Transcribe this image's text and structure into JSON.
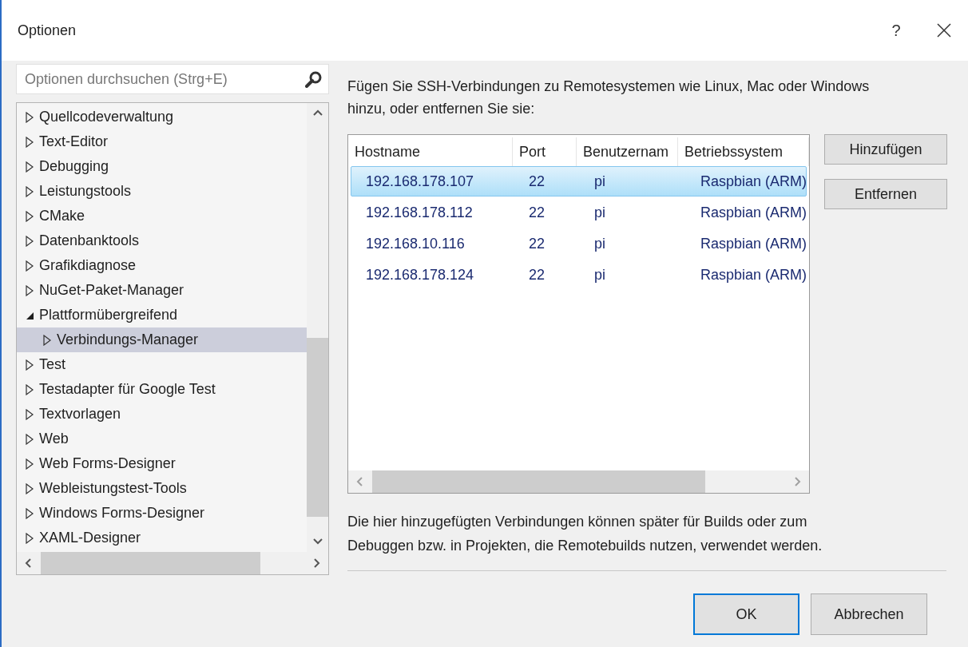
{
  "window": {
    "title": "Optionen",
    "help": "?"
  },
  "search": {
    "placeholder": "Optionen durchsuchen (Strg+E)"
  },
  "tree": [
    {
      "label": "Quellcodeverwaltung",
      "expanded": false,
      "selected": false
    },
    {
      "label": "Text-Editor",
      "expanded": false,
      "selected": false
    },
    {
      "label": "Debugging",
      "expanded": false,
      "selected": false
    },
    {
      "label": "Leistungstools",
      "expanded": false,
      "selected": false
    },
    {
      "label": "CMake",
      "expanded": false,
      "selected": false
    },
    {
      "label": "Datenbanktools",
      "expanded": false,
      "selected": false
    },
    {
      "label": "Grafikdiagnose",
      "expanded": false,
      "selected": false
    },
    {
      "label": "NuGet-Paket-Manager",
      "expanded": false,
      "selected": false
    },
    {
      "label": "Plattformübergreifend",
      "expanded": true,
      "selected": false,
      "children": [
        {
          "label": "Verbindungs-Manager",
          "expanded": false,
          "selected": true
        }
      ]
    },
    {
      "label": "Test",
      "expanded": false,
      "selected": false
    },
    {
      "label": "Testadapter für Google Test",
      "expanded": false,
      "selected": false
    },
    {
      "label": "Textvorlagen",
      "expanded": false,
      "selected": false
    },
    {
      "label": "Web",
      "expanded": false,
      "selected": false
    },
    {
      "label": "Web Forms-Designer",
      "expanded": false,
      "selected": false
    },
    {
      "label": "Webleistungstest-Tools",
      "expanded": false,
      "selected": false
    },
    {
      "label": "Windows Forms-Designer",
      "expanded": false,
      "selected": false
    },
    {
      "label": "XAML-Designer",
      "expanded": false,
      "selected": false
    }
  ],
  "intro": "Fügen Sie SSH-Verbindungen zu Remotesystemen wie Linux, Mac oder Windows hinzu, oder entfernen Sie sie:",
  "table": {
    "columns": [
      "Hostname",
      "Port",
      "Benutzernam",
      "Betriebssystem"
    ],
    "rows": [
      {
        "cells": [
          "192.168.178.107",
          "22",
          "pi",
          "Raspbian (ARM)"
        ],
        "selected": true
      },
      {
        "cells": [
          "192.168.178.112",
          "22",
          "pi",
          "Raspbian (ARM)"
        ],
        "selected": false
      },
      {
        "cells": [
          "192.168.10.116",
          "22",
          "pi",
          "Raspbian (ARM)"
        ],
        "selected": false
      },
      {
        "cells": [
          "192.168.178.124",
          "22",
          "pi",
          "Raspbian (ARM)"
        ],
        "selected": false
      }
    ]
  },
  "side_buttons": [
    "Hinzufügen",
    "Entfernen"
  ],
  "note": "Die hier hinzugefügten Verbindungen können später für Builds oder zum Debuggen bzw. in Projekten, die Remotebuilds nutzen, verwendet werden.",
  "buttons": [
    {
      "label": "OK",
      "default": true
    },
    {
      "label": "Abbrechen",
      "default": false
    }
  ]
}
